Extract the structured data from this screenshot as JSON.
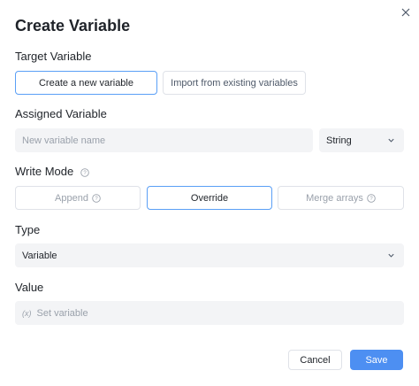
{
  "dialog": {
    "title": "Create Variable",
    "close_icon": "close-icon"
  },
  "target": {
    "label": "Target Variable",
    "options": [
      "Create a new variable",
      "Import from existing variables"
    ],
    "selected": "Create a new variable"
  },
  "assigned": {
    "label": "Assigned Variable",
    "name_placeholder": "New variable name",
    "type_value": "String"
  },
  "write_mode": {
    "label": "Write Mode",
    "options": [
      "Append",
      "Override",
      "Merge arrays"
    ],
    "selected": "Override"
  },
  "type": {
    "label": "Type",
    "value": "Variable"
  },
  "value": {
    "label": "Value",
    "prefix": "(x)",
    "placeholder": "Set variable"
  },
  "footer": {
    "cancel_label": "Cancel",
    "save_label": "Save"
  },
  "colors": {
    "accent": "#4d8ff2",
    "active_border": "#5a9ff6",
    "field_bg": "#f3f4f6"
  }
}
